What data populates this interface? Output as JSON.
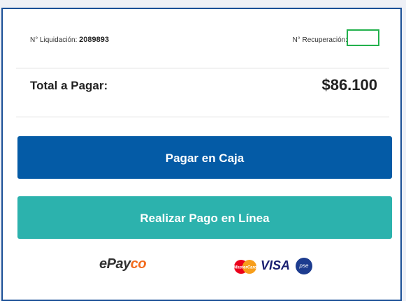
{
  "liquidacion": {
    "label": "N° Liquidación:",
    "value": "2089893"
  },
  "recuperacion": {
    "label": "N° Recuperación:",
    "value": ""
  },
  "total": {
    "label": "Total a Pagar:",
    "amount": "$86.100"
  },
  "buttons": {
    "pagar_caja": "Pagar en Caja",
    "pago_linea": "Realizar Pago en Línea"
  },
  "logos": {
    "epayco_prefix": "ePay",
    "epayco_suffix": "co",
    "visa": "VISA",
    "mastercard": "MasterCard",
    "pse": "pse"
  },
  "colors": {
    "primary_button": "#045ba6",
    "secondary_button": "#2cb2ad",
    "highlight_box": "#22b14c"
  }
}
